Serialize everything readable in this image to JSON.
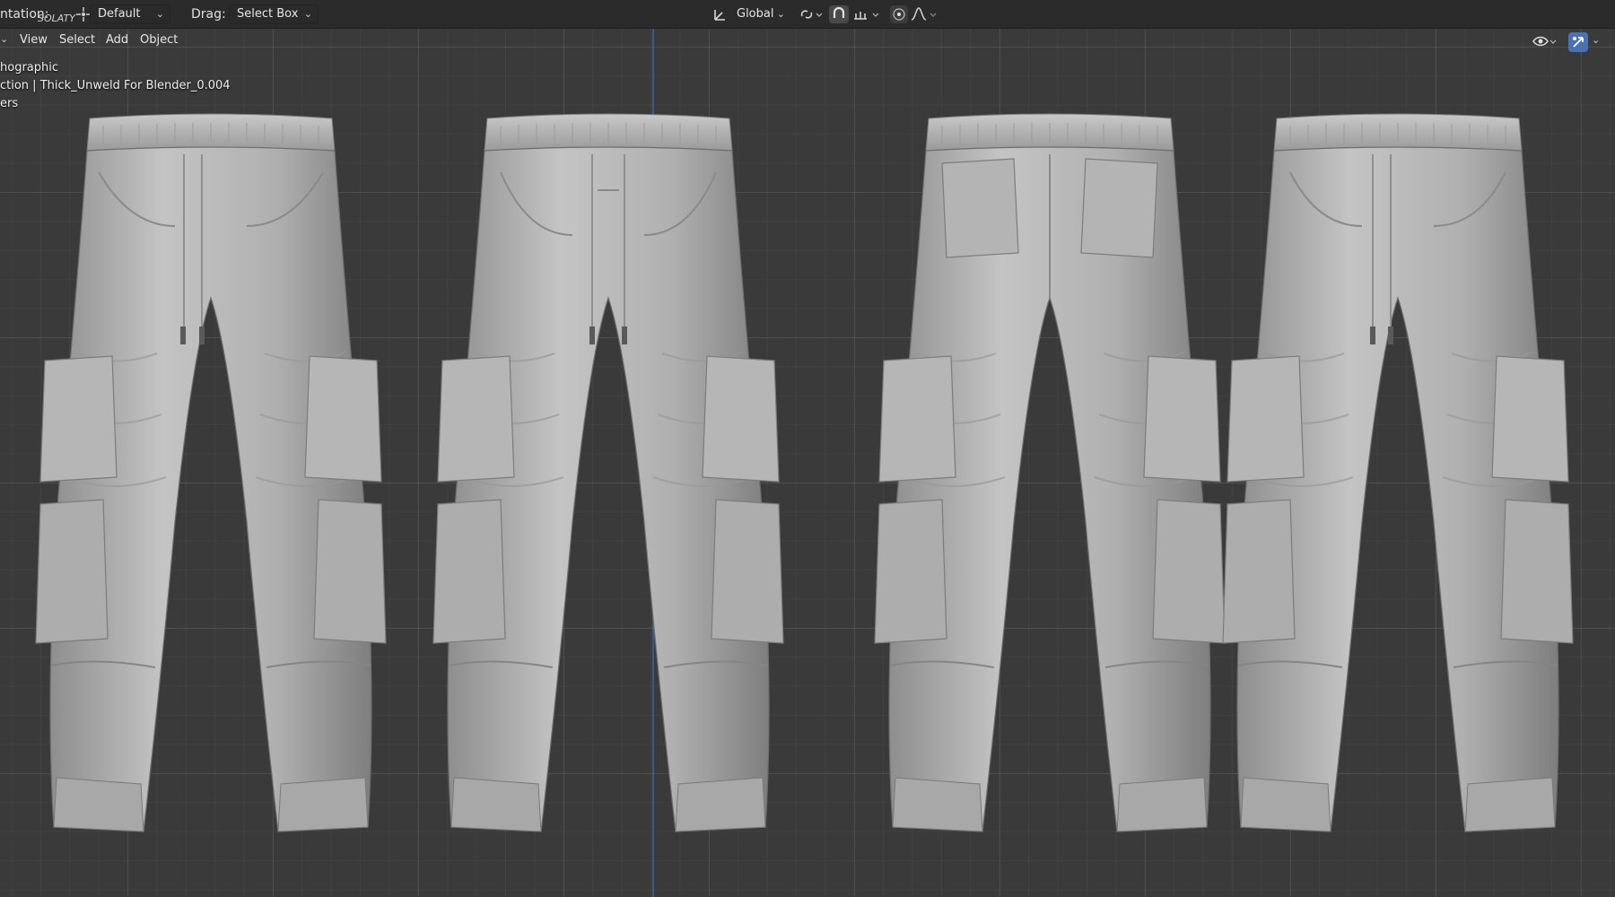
{
  "header": {
    "orientation_label": "ntation:",
    "orientation_sub": "SOLATY",
    "pivot_dropdown": "Default",
    "drag_label": "Drag:",
    "drag_dropdown": "Select Box",
    "transform_orientation": "Global",
    "icons": [
      "transform-orientation-icon",
      "pivot-icon",
      "snap-magnet-icon",
      "snap-increment-icon",
      "proportional-edit-icon",
      "falloff-curve-icon"
    ]
  },
  "viewport_menu": {
    "items": [
      "View",
      "Select",
      "Add",
      "Object"
    ]
  },
  "viewport_info": {
    "view_name": "hographic",
    "collection_line": "ction | Thick_Unweld For Blender_0.004",
    "filters_line": "ers"
  },
  "viewport_header_right": {
    "icons": [
      "visibility-eye-icon",
      "gizmo-toggle-icon"
    ]
  },
  "colors": {
    "background": "#3a3a3a",
    "header": "#2b2b2b",
    "z_axis": "#3d5f92",
    "active_gizmo": "#4772b3",
    "mesh": "#b9b9b9"
  },
  "scene": {
    "objects": [
      "cargo-pants-front-left-view",
      "cargo-pants-front-view",
      "cargo-pants-back-view",
      "cargo-pants-back-right-view"
    ]
  }
}
